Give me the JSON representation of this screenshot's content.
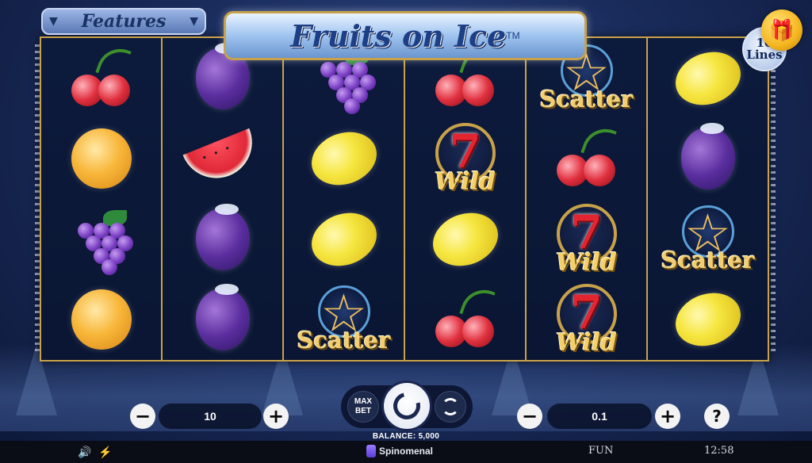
{
  "header": {
    "features_label": "Features",
    "title": "Fruits on Ice",
    "trademark": "TM",
    "lines_count": "10",
    "lines_label": "Lines"
  },
  "reels": [
    [
      "cherries",
      "orange",
      "grapes",
      "orange"
    ],
    [
      "plum",
      "watermelon",
      "plum",
      "plum"
    ],
    [
      "grapes",
      "lemon",
      "lemon",
      "scatter"
    ],
    [
      "cherries",
      "seven-wild",
      "lemon",
      "cherries"
    ],
    [
      "scatter",
      "cherries",
      "seven-wild",
      "seven-wild"
    ],
    [
      "lemon",
      "plum",
      "scatter",
      "lemon"
    ]
  ],
  "symbols": {
    "seven_number": "7",
    "wild_label": "Wild",
    "scatter_label": "Scatter"
  },
  "controls": {
    "lines_value": "10",
    "bet_value": "0.1",
    "minus": "−",
    "plus": "+",
    "help": "?",
    "max_bet_line1": "MAX",
    "max_bet_line2": "BET",
    "balance": "BALANCE: 5,000"
  },
  "status": {
    "brand": "Spinomenal",
    "mode": "FUN",
    "time": "12:58"
  }
}
